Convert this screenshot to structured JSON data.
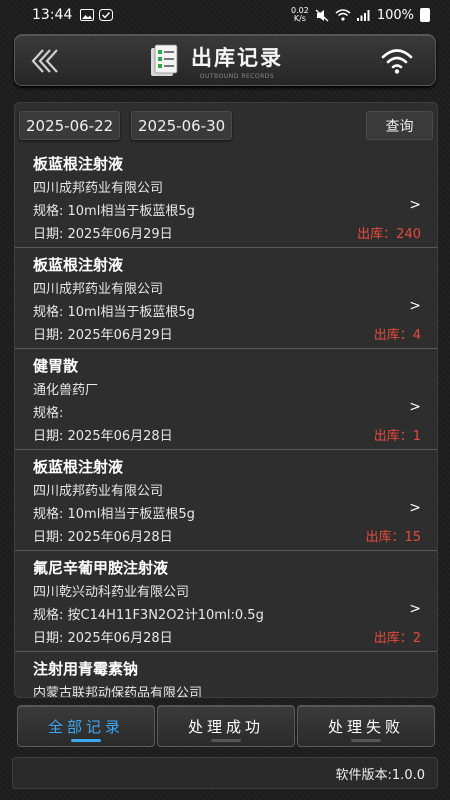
{
  "status_bar": {
    "time": "13:44",
    "net_speed_value": "0.02",
    "net_speed_unit": "K/s",
    "battery": "100%"
  },
  "header": {
    "title": "出库记录",
    "subtitle": "OUTBOUND RECORDS"
  },
  "filter": {
    "start_date": "2025-06-22",
    "end_date": "2025-06-30",
    "query_label": "查询"
  },
  "records": [
    {
      "name": "板蓝根注射液",
      "company": "四川成邦药业有限公司",
      "spec": "规格: 10ml相当于板蓝根5g",
      "date": "日期: 2025年06月29日",
      "out": "出库：240"
    },
    {
      "name": "板蓝根注射液",
      "company": "四川成邦药业有限公司",
      "spec": "规格: 10ml相当于板蓝根5g",
      "date": "日期: 2025年06月29日",
      "out": "出库：4"
    },
    {
      "name": "健胃散",
      "company": "通化兽药厂",
      "spec": "规格:",
      "date": "日期: 2025年06月28日",
      "out": "出库：1"
    },
    {
      "name": "板蓝根注射液",
      "company": "四川成邦药业有限公司",
      "spec": "规格: 10ml相当于板蓝根5g",
      "date": "日期: 2025年06月28日",
      "out": "出库：15"
    },
    {
      "name": "氟尼辛葡甲胺注射液",
      "company": "四川乾兴动科药业有限公司",
      "spec": "规格: 按C14H11F3N2O2计10ml:0.5g",
      "date": "日期: 2025年06月28日",
      "out": "出库：2"
    },
    {
      "name": "注射用青霉素钠",
      "company": "内蒙古联邦动保药品有限公司",
      "spec": "",
      "date": "",
      "out": ""
    }
  ],
  "arrow_glyph": ">",
  "tabs": [
    {
      "label": "全部记录"
    },
    {
      "label": "处理成功"
    },
    {
      "label": "处理失败"
    }
  ],
  "footer": {
    "version": "软件版本:1.0.0"
  },
  "colors": {
    "accent": "#3fa8f5",
    "out_red": "#e84a3c",
    "background": "#1d1d1d"
  }
}
